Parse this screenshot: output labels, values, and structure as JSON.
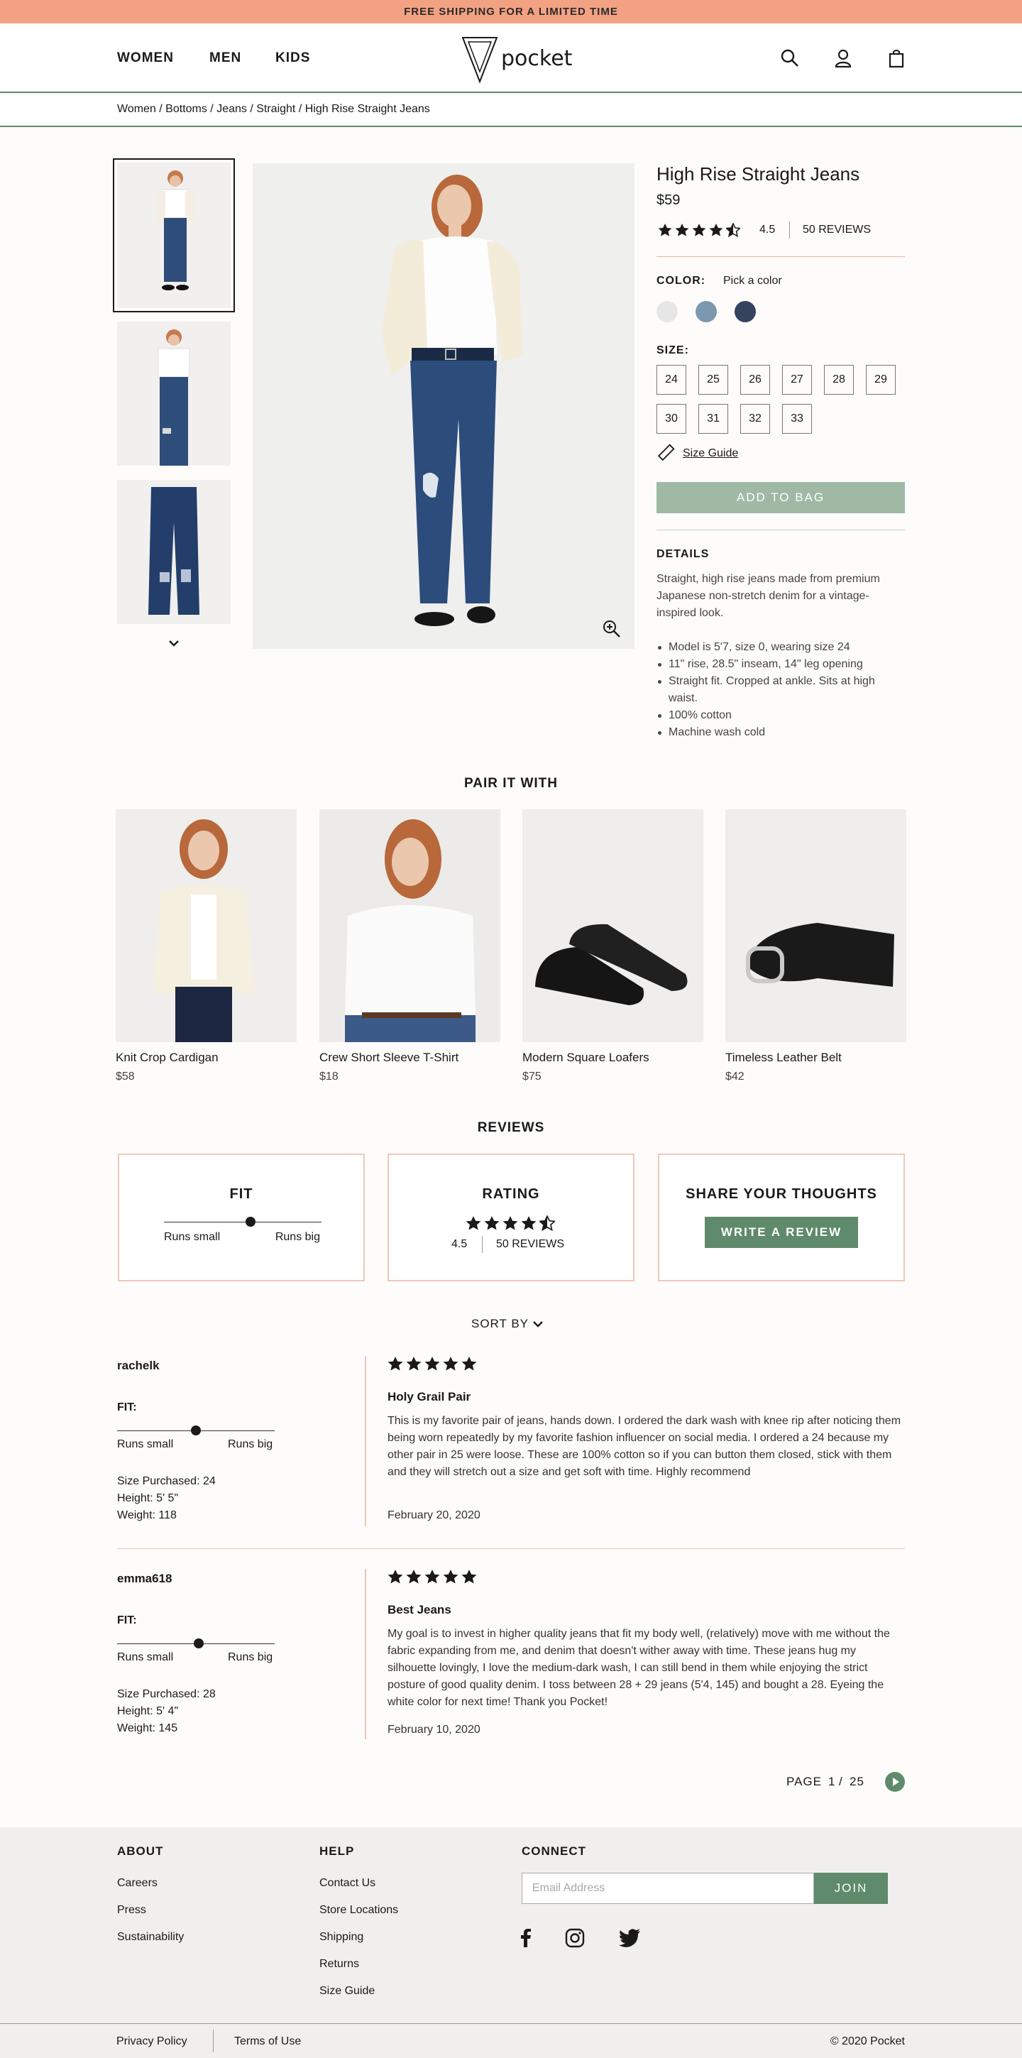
{
  "banner": "FREE SHIPPING FOR A LIMITED TIME",
  "nav": {
    "women": "WOMEN",
    "men": "MEN",
    "kids": "KIDS"
  },
  "logo": "pocket",
  "breadcrumb": "Women / Bottoms / Jeans / Straight / High Rise Straight Jeans",
  "product": {
    "title": "High Rise Straight Jeans",
    "price": "$59",
    "rating": "4.5",
    "rating_value": 4.5,
    "reviews": "50 REVIEWS",
    "color_label": "COLOR:",
    "color_hint": "Pick a color",
    "colors": [
      "#e6e6e6",
      "#7c97b0",
      "#34445e"
    ],
    "size_label": "SIZE:",
    "sizes": [
      "24",
      "25",
      "26",
      "27",
      "28",
      "29",
      "30",
      "31",
      "32",
      "33"
    ],
    "size_guide": "Size Guide",
    "add_to_bag": "ADD TO BAG",
    "details_label": "DETAILS",
    "description": "Straight, high rise jeans made from premium Japanese non-stretch denim for a vintage-inspired look.",
    "bullets": [
      "Model is 5'7, size 0, wearing size 24",
      "11\" rise, 28.5\" inseam, 14\" leg opening",
      "Straight fit. Cropped at ankle. Sits at high waist.",
      "100% cotton",
      "Machine wash cold"
    ]
  },
  "pair": {
    "title": "PAIR IT WITH",
    "items": [
      {
        "name": "Knit Crop Cardigan",
        "price": "$58"
      },
      {
        "name": "Crew Short Sleeve T-Shirt",
        "price": "$18"
      },
      {
        "name": "Modern Square Loafers",
        "price": "$75"
      },
      {
        "name": "Timeless Leather Belt",
        "price": "$42"
      }
    ]
  },
  "reviews_section": {
    "title": "REVIEWS",
    "fit_title": "FIT",
    "runs_small": "Runs small",
    "runs_big": "Runs big",
    "fit_value": 0.55,
    "rating_title": "RATING",
    "rating": "4.5",
    "reviews": "50 REVIEWS",
    "share_title": "SHARE YOUR THOUGHTS",
    "write_review": "WRITE A REVIEW",
    "sort_by": "SORT BY"
  },
  "reviews": [
    {
      "user": "rachelk",
      "fit_label": "FIT:",
      "fit_value": 0.5,
      "size": "Size Purchased: 24",
      "height": "Height: 5' 5\"",
      "weight": "Weight: 118",
      "stars": 5,
      "title": "Holy Grail Pair",
      "text": "This is my favorite pair of jeans, hands down. I ordered the dark wash with knee rip after noticing them being worn repeatedly by my favorite fashion influencer on social media. I ordered a 24 because my other pair in 25 were loose. These are 100% cotton so if you can button them closed, stick with them and they will stretch out a size and get soft with time. Highly recommend",
      "date": "February 20, 2020"
    },
    {
      "user": "emma618",
      "fit_label": "FIT:",
      "fit_value": 0.5,
      "size": "Size Purchased: 28",
      "height": "Height: 5' 4\"",
      "weight": "Weight: 145",
      "stars": 5,
      "title": "Best Jeans",
      "text": "My goal is to invest in higher quality jeans that fit my body well, (relatively) move with me without the fabric expanding from me, and denim that doesn't wither away with time. These jeans hug my silhouette lovingly, I love the medium-dark wash, I can still bend in them while enjoying the strict posture of good quality denim. I toss between 28 + 29 jeans (5'4, 145) and bought a 28. Eyeing the white color for next time! Thank you Pocket!",
      "date": "February 10, 2020"
    }
  ],
  "pagination": {
    "label": "PAGE",
    "current": "1",
    "sep": "/",
    "total": "25"
  },
  "footer": {
    "about": {
      "title": "ABOUT",
      "links": [
        "Careers",
        "Press",
        "Sustainability"
      ]
    },
    "help": {
      "title": "HELP",
      "links": [
        "Contact Us",
        "Store Locations",
        "Shipping",
        "Returns",
        "Size Guide"
      ]
    },
    "connect": {
      "title": "CONNECT",
      "email_placeholder": "Email Address",
      "join": "JOIN"
    },
    "privacy": "Privacy Policy",
    "terms": "Terms of Use",
    "copyright": "© 2020 Pocket"
  },
  "colors": {
    "accent": "#5f8a6b",
    "banner": "#f3a183",
    "add_to_bag": "#9fb9a5",
    "divider": "#f0c3b3"
  }
}
